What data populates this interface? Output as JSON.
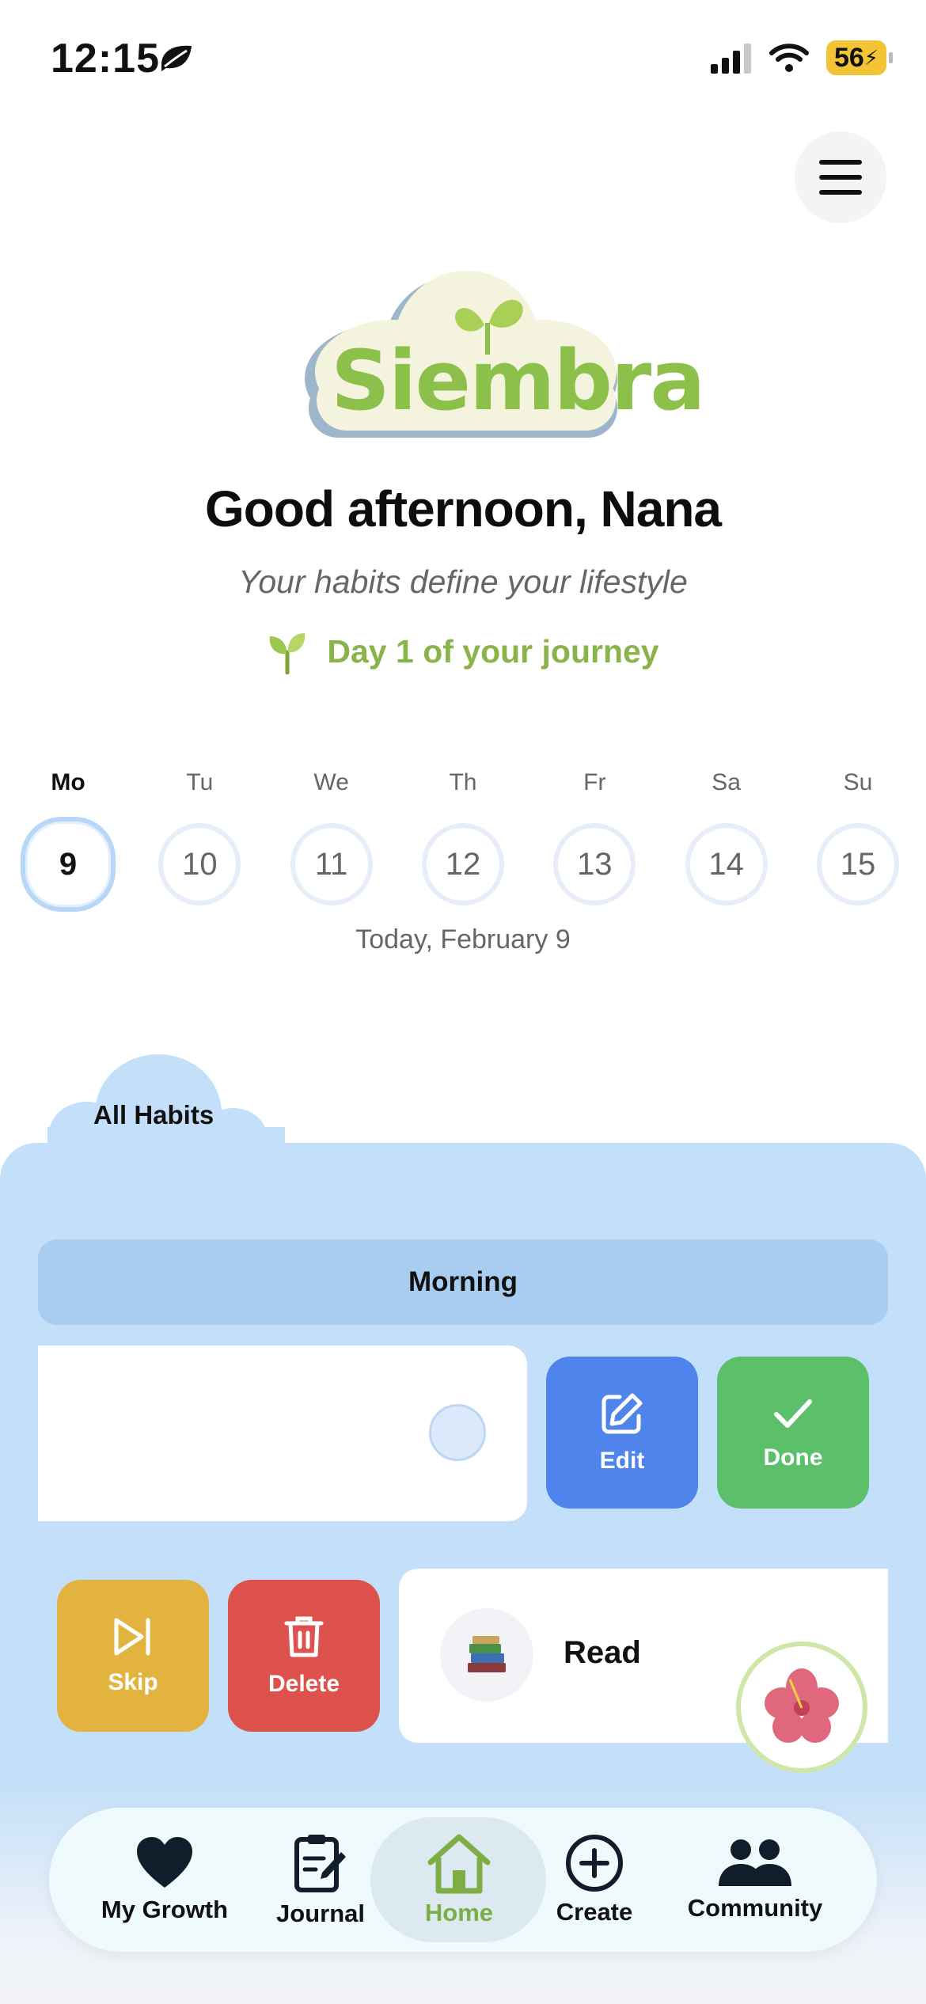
{
  "status_bar": {
    "time": "12:15",
    "battery": "56"
  },
  "logo_text": "Siembra",
  "greeting": "Good afternoon, Nana",
  "tagline": "Your habits define your lifestyle",
  "journey": "Day 1 of your journey",
  "week": {
    "days": [
      {
        "name": "Mo",
        "date": "9"
      },
      {
        "name": "Tu",
        "date": "10"
      },
      {
        "name": "We",
        "date": "11"
      },
      {
        "name": "Th",
        "date": "12"
      },
      {
        "name": "Fr",
        "date": "13"
      },
      {
        "name": "Sa",
        "date": "14"
      },
      {
        "name": "Su",
        "date": "15"
      }
    ],
    "today_label": "Today, February 9"
  },
  "habits": {
    "tab_label": "All Habits",
    "section": "Morning",
    "actions": {
      "edit": "Edit",
      "done": "Done",
      "skip": "Skip",
      "delete": "Delete"
    },
    "read_label": "Read"
  },
  "nav": {
    "my_growth": "My Growth",
    "journal": "Journal",
    "home": "Home",
    "create": "Create",
    "community": "Community"
  },
  "colors": {
    "accent_green": "#8ab34a",
    "panel_blue": "#c4dff9",
    "edit_blue": "#4f84ec",
    "done_green": "#5bc069",
    "skip_yellow": "#e2b43f",
    "delete_red": "#de524d"
  }
}
